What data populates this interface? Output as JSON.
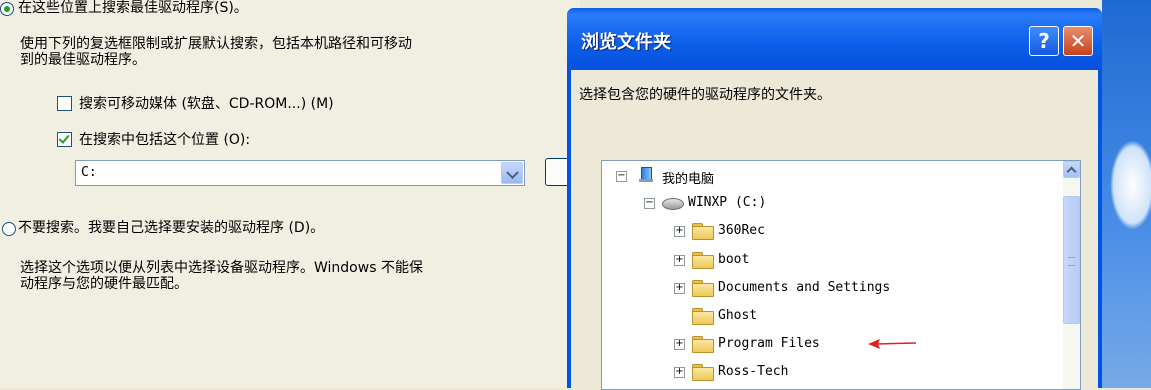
{
  "wizard": {
    "line_top": "在这些位置上搜索最佳驱动程序(S)。",
    "desc_line1": "使用下列的复选框限制或扩展默认搜索，包括本机路径和可移动",
    "desc_line2": "到的最佳驱动程序。",
    "checkbox_removable": "搜索可移动媒体 (软盘、CD-ROM...) (M)",
    "checkbox_include": "在搜索中包括这个位置 (O):",
    "path_value": "C:",
    "radio_dont_search": "不要搜索。我要自己选择要安装的驱动程序 (D)。",
    "desc2_line1": "选择这个选项以便从列表中选择设备驱动程序。Windows 不能保",
    "desc2_line2": "动程序与您的硬件最匹配。"
  },
  "dialog": {
    "title": "浏览文件夹",
    "help_label": "?",
    "close_label": "✕",
    "description": "选择包含您的硬件的驱动程序的文件夹。",
    "tree": [
      {
        "label": "我的电脑",
        "level": 0,
        "expander": "⊟",
        "icon": "computer-icon"
      },
      {
        "label": "WINXP (C:)",
        "level": 1,
        "expander": "⊟",
        "icon": "drive-icon"
      },
      {
        "label": "360Rec",
        "level": 2,
        "expander": "+",
        "icon": "folder-icon"
      },
      {
        "label": "boot",
        "level": 2,
        "expander": "+",
        "icon": "folder-icon"
      },
      {
        "label": "Documents and Settings",
        "level": 2,
        "expander": "+",
        "icon": "folder-icon"
      },
      {
        "label": "Ghost",
        "level": 2,
        "expander": "",
        "icon": "folder-icon"
      },
      {
        "label": "Program Files",
        "level": 2,
        "expander": "+",
        "icon": "folder-icon"
      },
      {
        "label": "Ross-Tech",
        "level": 2,
        "expander": "+",
        "icon": "folder-icon"
      }
    ]
  },
  "annotation": {
    "arrow_color": "#e02020"
  }
}
